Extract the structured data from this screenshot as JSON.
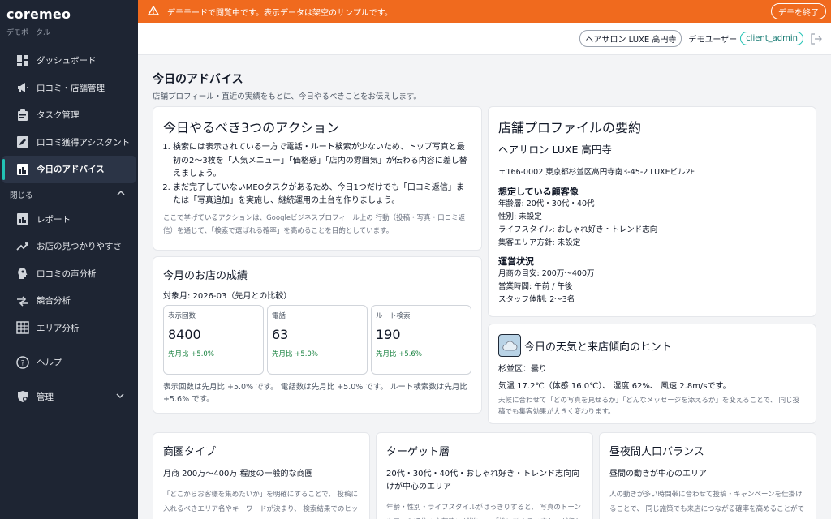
{
  "sidebar": {
    "logo": "coremeo",
    "subtitle": "デモポータル",
    "items": [
      {
        "label": "ダッシュボード",
        "icon": "dashboard-icon"
      },
      {
        "label": "口コミ・店舗管理",
        "icon": "megaphone-icon"
      },
      {
        "label": "タスク管理",
        "icon": "clipboard-icon"
      },
      {
        "label": "口コミ獲得アシスタント",
        "icon": "edit-icon"
      },
      {
        "label": "今日のアドバイス",
        "icon": "bar-chart-icon"
      }
    ],
    "section_label": "閉じる",
    "section_items": [
      {
        "label": "レポート",
        "icon": "chart-icon"
      },
      {
        "label": "お店の見つかりやすさ",
        "icon": "trend-icon"
      },
      {
        "label": "口コミの声分析",
        "icon": "head-icon"
      },
      {
        "label": "競合分析",
        "icon": "compare-icon"
      },
      {
        "label": "エリア分析",
        "icon": "grid-icon"
      }
    ],
    "help_label": "ヘルプ",
    "admin_label": "管理"
  },
  "banner": {
    "text": "デモモードで閲覧中です。表示データは架空のサンプルです。",
    "end_button": "デモを終了",
    "color": "#f06a1e"
  },
  "topbar": {
    "shop": "ヘアサロン LUXE 高円寺",
    "user_label": "デモユーザー",
    "user_id": "client_admin"
  },
  "page": {
    "title": "今日のアドバイス",
    "description": "店舗プロフィール・直近の実績をもとに、今日やるべきことをお伝えします。"
  },
  "actions": {
    "title": "今日やるべき3つのアクション",
    "items": [
      "検索には表示されている一方で電話・ルート検索が少ないため、トップ写真と最初の2〜3枚を「人気メニュー」「価格感」「店内の雰囲気」が伝わる内容に差し替えましょう。",
      "まだ完了していないMEOタスクがあるため、今日1つだけでも「口コミ返信」または「写真追加」を実施し、継続運用の土台を作りましょう。"
    ],
    "note": "ここで挙げているアクションは、Googleビジネスプロフィール上の 行動（投稿・写真・口コミ返信）を通じて、「検索で選ばれる確率」を高めることを目的としています。"
  },
  "performance": {
    "title": "今月のお店の成績",
    "period": "対象月: 2026-03（先月との比較）",
    "metrics": [
      {
        "label": "表示回数",
        "value": "8400",
        "change": "先月比 +5.0%"
      },
      {
        "label": "電話",
        "value": "63",
        "change": "先月比 +5.0%"
      },
      {
        "label": "ルート検索",
        "value": "190",
        "change": "先月比 +5.6%"
      }
    ],
    "summary": "表示回数は先月比 +5.0% です。 電話数は先月比 +5.0% です。 ルート検索数は先月比 +5.6% です。"
  },
  "profile": {
    "title": "店舗プロファイルの要約",
    "name": "ヘアサロン LUXE 高円寺",
    "address": "〒166-0002 東京都杉並区高円寺南3-45-2 LUXEビル2F",
    "customer_title": "想定している顧客像",
    "customer": [
      "年齢層: 20代・30代・40代",
      "性別: 未設定",
      "ライフスタイル: おしゃれ好き・トレンド志向",
      "集客エリア方針: 未設定"
    ],
    "ops_title": "運営状況",
    "ops": [
      "月商の目安: 200万〜400万",
      "営業時間: 午前 / 午後",
      "スタッフ体制: 2〜3名"
    ]
  },
  "weather": {
    "title": "今日の天気と来店傾向のヒント",
    "icon": "cloud-icon",
    "location": "杉並区：曇り",
    "detail": "気温 17.2℃（体感 16.0℃）、 湿度 62%、 風速 2.8m/sです。",
    "note": "天候に合わせて「どの写真を見せるか」「どんなメッセージを添えるか」を変えることで、 同じ投稿でも集客効果が大きく変わります。"
  },
  "bottom": [
    {
      "title": "商圏タイプ",
      "bold": "月商 200万〜400万 程度の一般的な商圏",
      "note": "「どこからお客様を集めたいか」を明確にすることで、 投稿に入れるべきエリア名やキーワードが決まり、 検索結果でのヒット率を高められます。"
    },
    {
      "title": "ターゲット層",
      "bold": "20代・30代・40代・おしゃれ好き・トレンド志向向けが中心のエリア",
      "note": "年齢・性別・ライフスタイルがはっきりすると、 写真のトーンや口コミ返信の言葉遣いが揃い、 「誰に刺さるお店か」が伝わります。"
    },
    {
      "title": "昼夜間人口バランス",
      "bold": "昼間の動きが中心のエリア",
      "note": "人の動きが多い時間帯に合わせて投稿・キャンペーンを仕掛けることで、 同じ施策でも来店につながる確率を高めることができます。"
    }
  ]
}
